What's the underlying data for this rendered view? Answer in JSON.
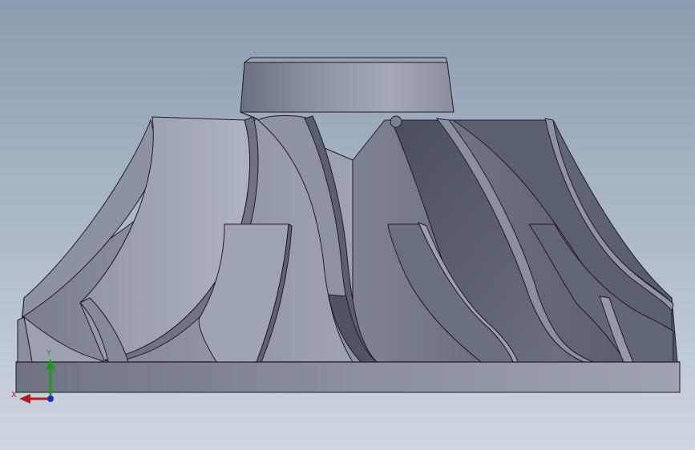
{
  "viewport": {
    "background_top": "#8a9cb0",
    "background_bottom": "#cfd6e0",
    "part_dark": "#4c5260",
    "part_mid": "#7a8090",
    "part_light": "#a8adba",
    "edge": "#1c1e24"
  },
  "triad": {
    "x_label": "X",
    "y_label": "Y",
    "x_color": "#c0141c",
    "y_color": "#1a9a1a",
    "z_color": "#1a2ad0"
  }
}
